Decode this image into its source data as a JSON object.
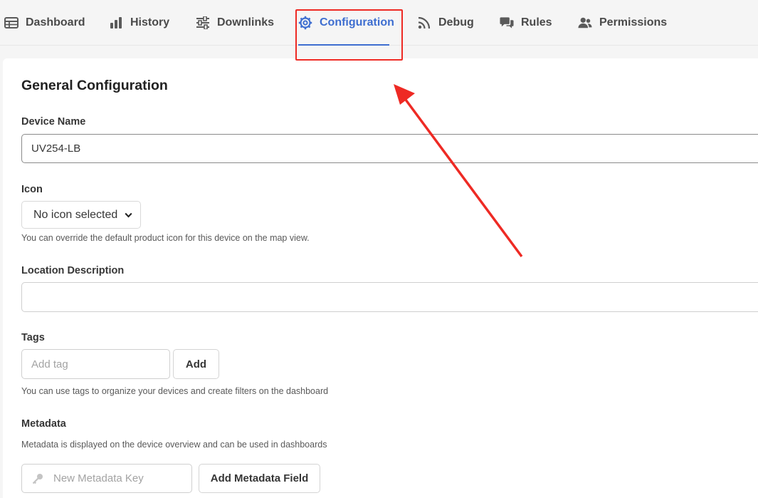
{
  "tabs": [
    {
      "label": "Dashboard",
      "icon": "table-icon",
      "active": false
    },
    {
      "label": "History",
      "icon": "bar-chart-icon",
      "active": false
    },
    {
      "label": "Downlinks",
      "icon": "sliders-icon",
      "active": false
    },
    {
      "label": "Configuration",
      "icon": "gear-icon",
      "active": true
    },
    {
      "label": "Debug",
      "icon": "rss-icon",
      "active": false
    },
    {
      "label": "Rules",
      "icon": "comments-icon",
      "active": false
    },
    {
      "label": "Permissions",
      "icon": "users-icon",
      "active": false
    }
  ],
  "config": {
    "title": "General Configuration",
    "device_name_label": "Device Name",
    "device_name_value": "UV254-LB",
    "icon_label": "Icon",
    "icon_selected": "No icon selected",
    "icon_help": "You can override the default product icon for this device on the map view.",
    "location_label": "Location Description",
    "location_value": "",
    "tags_label": "Tags",
    "tags_placeholder": "Add tag",
    "tags_add_button": "Add",
    "tags_help": "You can use tags to organize your devices and create filters on the dashboard",
    "metadata_label": "Metadata",
    "metadata_help": "Metadata is displayed on the device overview and can be used in dashboards",
    "metadata_key_placeholder": "New Metadata Key",
    "metadata_add_button": "Add Metadata Field"
  },
  "colors": {
    "accent": "#3e6ed0",
    "annotation": "#ee2a24"
  }
}
